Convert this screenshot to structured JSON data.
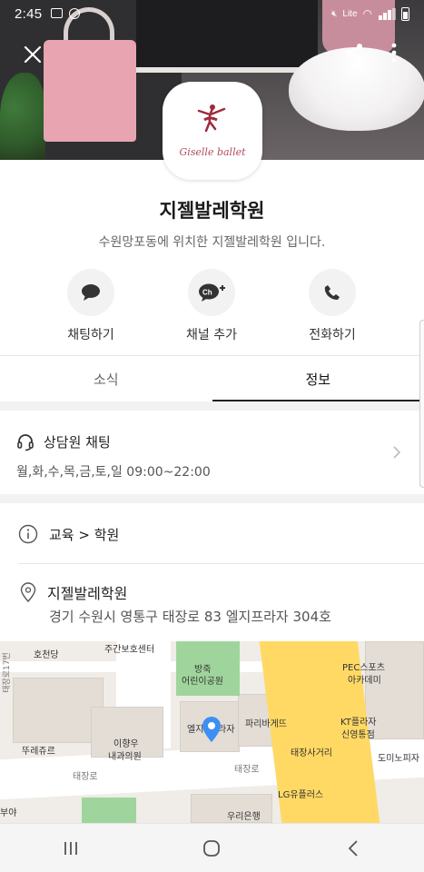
{
  "status_bar": {
    "time": "2:45",
    "network": "Lite"
  },
  "header": {
    "close_icon": "close-icon",
    "share_icon": "share-icon",
    "more_icon": "more-vertical-icon"
  },
  "profile": {
    "logo_text": "Giselle ballet",
    "name": "지젤발레학원",
    "description": "수원망포동에 위치한 지젤발레학원 입니다."
  },
  "actions": [
    {
      "label": "채팅하기",
      "icon": "chat-bubble-icon"
    },
    {
      "label": "채널 추가",
      "icon": "channel-add-icon",
      "badge": "Ch+"
    },
    {
      "label": "전화하기",
      "icon": "phone-icon"
    }
  ],
  "tabs": [
    {
      "label": "소식",
      "active": false
    },
    {
      "label": "정보",
      "active": true
    }
  ],
  "info": {
    "consult_label": "상담원 채팅",
    "consult_hours": "월,화,수,목,금,토,일 09:00~22:00",
    "category": "교육 > 학원",
    "place_name": "지젤발레학원",
    "address": "경기 수원시 영통구 태장로 83 엘지프라자 304호"
  },
  "map": {
    "labels": {
      "l1": "호천당",
      "l2": "주간보호센터",
      "l3": "방죽",
      "l4": "어린이공원",
      "l5": "PEC스포츠",
      "l6": "아카데미",
      "l7": "파리바게뜨",
      "l8": "엘지",
      "l8b": "라자",
      "l9": "KT플라자",
      "l10": "신영통점",
      "l11": "도미노피자",
      "l12": "뚜레쥬르",
      "l13": "이향우",
      "l14": "내과의원",
      "l15": "태장로",
      "l16": "태장로",
      "l17": "태장사거리",
      "l18": "LG유플러스",
      "l19": "우리은행",
      "l20": "부야",
      "l21": "태장로17번"
    }
  },
  "nav": {
    "recent_icon": "recent-apps-icon",
    "home_icon": "home-icon",
    "back_icon": "back-icon"
  }
}
